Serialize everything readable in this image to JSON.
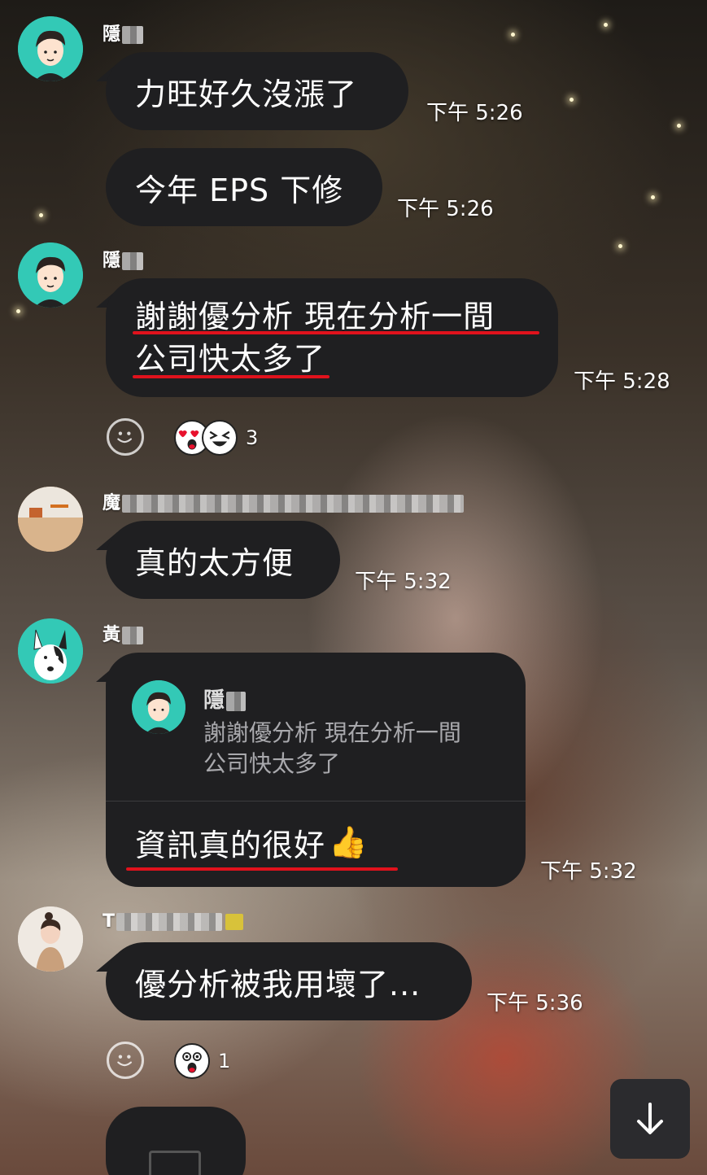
{
  "messages": [
    {
      "sender": "隱",
      "text": "力旺好久沒漲了",
      "time": "下午 5:26"
    },
    {
      "text": "今年 EPS 下修",
      "time": "下午 5:26"
    },
    {
      "sender": "隱",
      "text_line1": "謝謝優分析 現在分析一間",
      "text_line2": "公司快太多了",
      "time": "下午 5:28",
      "reaction_count": "3"
    },
    {
      "sender": "魔",
      "text": "真的太方便",
      "time": "下午 5:32"
    },
    {
      "sender": "黃",
      "quote": {
        "name": "隱",
        "line1": "謝謝優分析 現在分析一間",
        "line2": "公司快太多了"
      },
      "text": "資訊真的很好",
      "emoji": "👍",
      "time": "下午 5:32"
    },
    {
      "sender": "T",
      "text": "優分析被我用壞了...",
      "time": "下午 5:36",
      "reaction_count": "1"
    }
  ],
  "colors": {
    "bubble": "#1f1f21",
    "underline": "#e0121c",
    "avatar_teal": "#33c9b6"
  },
  "icons": {
    "scroll_down": "arrow-down-icon",
    "add_reaction": "smiley-outline-icon",
    "attachment": "image-icon"
  }
}
